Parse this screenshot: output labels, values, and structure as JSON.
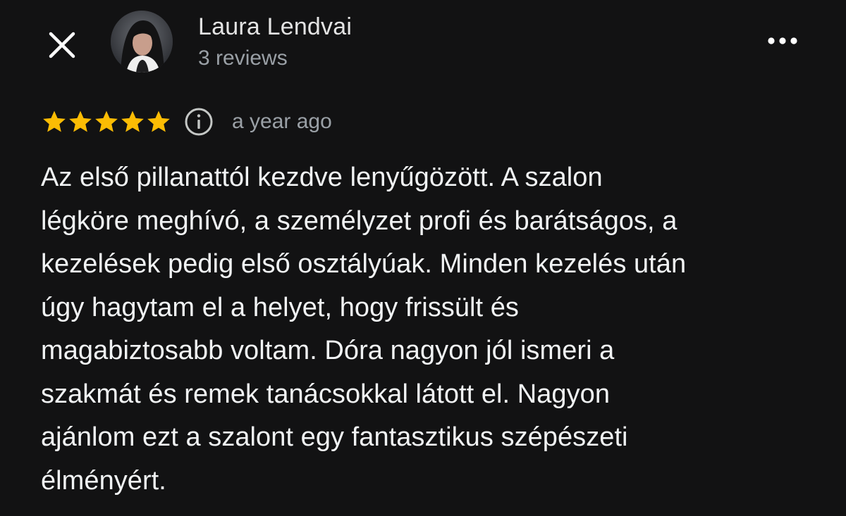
{
  "header": {
    "close_icon": "close-icon",
    "avatar_icon": "user-avatar",
    "author_name": "Laura Lendvai",
    "review_count": "3 reviews",
    "more_icon": "more-horizontal-icon"
  },
  "review": {
    "rating": 5,
    "rating_max": 5,
    "star_color": "#fbbc04",
    "info_icon": "info-icon",
    "time_ago": "a year ago",
    "text_lines": [
      "Az első pillanattól kezdve lenyűgözött. A szalon",
      "légköre meghívó, a személyzet profi és barátságos, a",
      "kezelések pedig első osztályúak. Minden kezelés után",
      "úgy hagytam el a helyet, hogy frissült és",
      "magabiztosabb voltam. Dóra nagyon jól ismeri a",
      "szakmát és remek tanácsokkal látott el. Nagyon",
      "ajánlom ezt a szalont egy fantasztikus szépészeti",
      "élményért."
    ]
  },
  "colors": {
    "background": "#121213",
    "primary_text": "#f1f3f4",
    "secondary_text": "#9aa0a6"
  }
}
